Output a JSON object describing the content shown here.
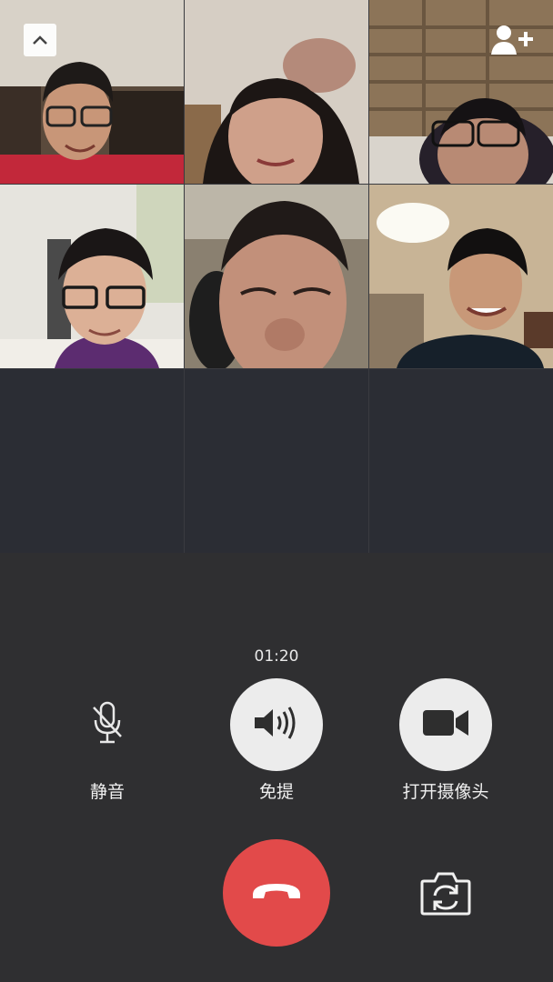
{
  "call": {
    "timer": "01:20"
  },
  "participants": [
    {
      "id": "p1",
      "state": "video"
    },
    {
      "id": "p2",
      "state": "video"
    },
    {
      "id": "p3",
      "state": "video"
    },
    {
      "id": "p4",
      "state": "video"
    },
    {
      "id": "p5",
      "state": "video"
    },
    {
      "id": "p6",
      "state": "video"
    }
  ],
  "controls": {
    "mute": {
      "label": "静音",
      "icon": "mic-off-icon"
    },
    "speaker": {
      "label": "免提",
      "icon": "speaker-icon"
    },
    "camera": {
      "label": "打开摄像头",
      "icon": "video-camera-icon"
    },
    "hangup": {
      "icon": "phone-hangup-icon"
    },
    "flip": {
      "icon": "camera-switch-icon"
    }
  },
  "top_bar": {
    "collapse_icon": "chevron-up-icon",
    "add_icon": "add-member-icon"
  },
  "colors": {
    "background": "#2f2f31",
    "empty_tile": "#2b2d34",
    "hangup": "#e24a4a",
    "control_circle": "#ececec"
  }
}
